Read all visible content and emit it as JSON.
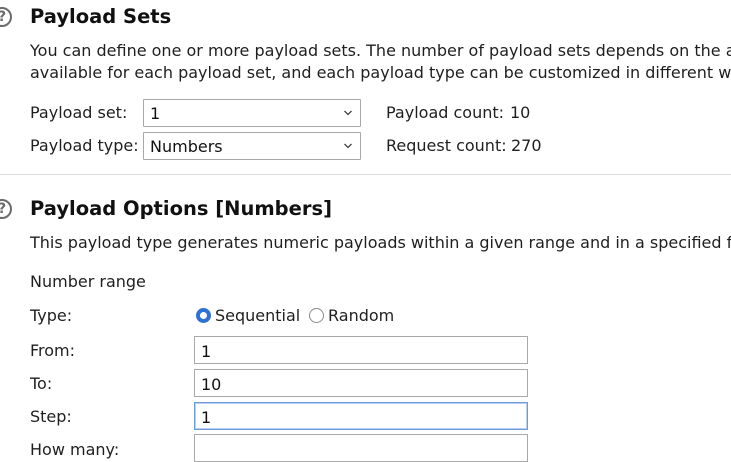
{
  "payload_sets": {
    "help_icon": "question-circle-icon",
    "title": "Payload Sets",
    "description_line1": "You can define one or more payload sets. The number of payload sets depends on the att",
    "description_line2": "available for each payload set, and each payload type can be customized in different ways",
    "payload_set_label": "Payload set:",
    "payload_set_value": "1",
    "payload_type_label": "Payload type:",
    "payload_type_value": "Numbers",
    "payload_count_label": "Payload count:",
    "payload_count_value": "10",
    "request_count_label": "Request count:",
    "request_count_value": "270"
  },
  "payload_options": {
    "help_icon": "question-circle-icon",
    "title": "Payload Options [Numbers]",
    "description": "This payload type generates numeric payloads within a given range and in a specified forr",
    "number_range_label": "Number range",
    "type_label": "Type:",
    "type_options": [
      {
        "label": "Sequential",
        "selected": true
      },
      {
        "label": "Random",
        "selected": false
      }
    ],
    "from_label": "From:",
    "from_value": "1",
    "to_label": "To:",
    "to_value": "10",
    "step_label": "Step:",
    "step_value": "1",
    "how_many_label": "How many:",
    "how_many_value": ""
  },
  "colors": {
    "accent": "#2f6fd6",
    "focus_border": "#6f9bd6"
  }
}
